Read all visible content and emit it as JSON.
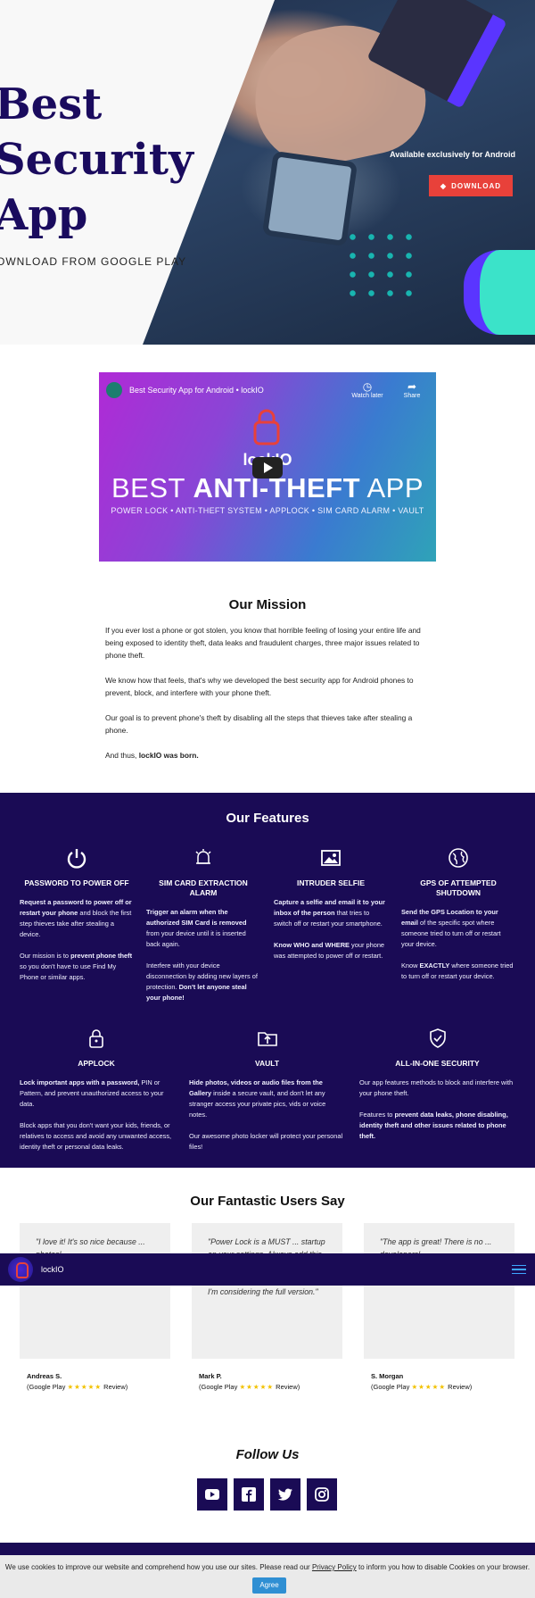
{
  "hero": {
    "title_line1": "Best",
    "title_line2": "Security",
    "title_line3": "App",
    "subtitle": "OWNLOAD FROM GOOGLE PLAY",
    "available_text": "Available exclusively for Android",
    "download_label": "DOWNLOAD"
  },
  "video": {
    "title": "Best Security App for Android • lockIO",
    "watch_later": "Watch later",
    "share": "Share",
    "brand": "lockIO",
    "headline_plain": "BEST",
    "headline_bold": "ANTI-THEFT",
    "headline_end": "APP",
    "features_line": "POWER LOCK • ANTI-THEFT SYSTEM • APPLOCK • SIM CARD ALARM • VAULT"
  },
  "mission": {
    "title": "Our Mission",
    "p1": "If you ever lost a phone or got stolen, you know that horrible feeling of losing your entire life and being exposed to identity theft, data leaks and fraudulent charges, three major issues related to phone theft.",
    "p2": "We know how that feels, that's why we developed the best security app for Android phones to prevent, block, and interfere with your phone theft.",
    "p3": "Our goal is to prevent phone's theft by disabling all the steps that thieves take after stealing a phone.",
    "p4_plain": "And thus,",
    "p4_bold": "lockIO was born."
  },
  "features": {
    "title": "Our Features",
    "items": [
      {
        "icon": "power-icon",
        "title": "PASSWORD TO POWER OFF",
        "p1_bold": "Request a password to power off or restart your phone",
        "p1_rest": " and block the first step thieves take after stealing a device.",
        "p2_plain": "Our mission is to ",
        "p2_bold": "prevent phone theft",
        "p2_rest": " so you don't have to use Find My Phone or similar apps."
      },
      {
        "icon": "alarm-bell-icon",
        "title": "SIM CARD EXTRACTION ALARM",
        "p1_bold": "Trigger an alarm when the authorized SIM Card is removed",
        "p1_rest": " from your device until it is inserted back again.",
        "p2_plain": "Interfere with your device disconnection by adding new layers of protection. ",
        "p2_bold": "Don't let anyone steal your phone!",
        "p2_rest": ""
      },
      {
        "icon": "image-icon",
        "title": "INTRUDER SELFIE",
        "p1_bold": "Capture a selfie and email it to your inbox of the person",
        "p1_rest": " that tries to switch off or restart your smartphone.",
        "p2_plain": "",
        "p2_bold": "Know WHO and WHERE",
        "p2_rest": " your phone was attempted to power off or restart."
      },
      {
        "icon": "globe-icon",
        "title": "GPS OF ATTEMPTED SHUTDOWN",
        "p1_bold": "Send the GPS Location to your email",
        "p1_rest": " of the specific spot where someone tried to turn off or restart your device.",
        "p2_plain": "Know ",
        "p2_bold": "EXACTLY",
        "p2_rest": " where someone tried to turn off or restart your device."
      },
      {
        "icon": "lock-icon",
        "title": "APPLOCK",
        "p1_bold": "Lock important apps with a password,",
        "p1_rest": " PIN or Pattern, and prevent unauthorized access to your data.",
        "p2_plain": "Block apps that you don't want your kids, friends, or relatives to access and avoid any unwanted access, identity theft or personal data leaks.",
        "p2_bold": "",
        "p2_rest": ""
      },
      {
        "icon": "folder-upload-icon",
        "title": "VAULT",
        "p1_bold": "Hide photos, videos or audio files from the Gallery",
        "p1_rest": " inside a secure vault, and don't let any stranger access your private pics, vids or voice notes.",
        "p2_plain": "Our awesome photo locker will protect your personal files!",
        "p2_bold": "",
        "p2_rest": ""
      },
      {
        "icon": "shield-check-icon",
        "title": "ALL-IN-ONE SECURITY",
        "p1_bold": "",
        "p1_rest": "Our app features methods to block and interfere with your phone theft.",
        "p2_plain": "Features to ",
        "p2_bold": "prevent data leaks, phone disabling, identity theft and other issues related to phone theft.",
        "p2_rest": ""
      }
    ]
  },
  "users": {
    "title": "Our Fantastic Users Say",
    "cards": [
      {
        "quote": "\"I love it! It's so nice because ... photos!",
        "name": "Andreas S.",
        "source_prefix": "(Google Play",
        "stars": "★★★★★",
        "source_suffix": "Review)"
      },
      {
        "quote": "\"Power Lock is a MUST ... startup on your settings. Always add this app (and others like Find My Phone). I'm glad for this app and I'm considering the full version.\"",
        "name": "Mark P.",
        "source_prefix": "(Google Play",
        "stars": "★★★★★",
        "source_suffix": "Review)"
      },
      {
        "quote": "\"The app is great! There is no ... developers!",
        "name": "S. Morgan",
        "source_prefix": "(Google Play",
        "stars": "★★★★★",
        "source_suffix": "Review)"
      }
    ]
  },
  "sticky": {
    "app_name": "lockIO"
  },
  "follow": {
    "title": "Follow Us",
    "icons": [
      "youtube-icon",
      "facebook-icon",
      "twitter-icon",
      "instagram-icon"
    ]
  },
  "cookie": {
    "text_before": "We use cookies to improve our website and comprehend how you use our sites. Please read our ",
    "link": "Privacy Policy",
    "text_after": " to inform you how to disable Cookies on your browser.",
    "agree_label": "Agree"
  }
}
